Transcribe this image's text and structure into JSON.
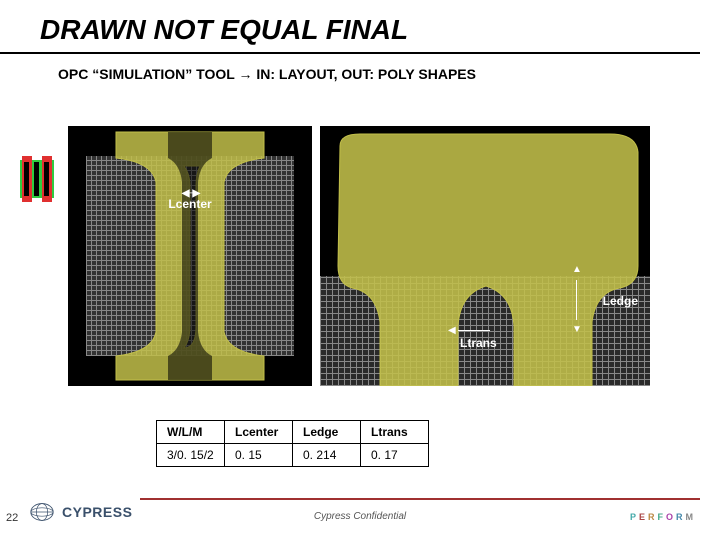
{
  "title": "DRAWN NOT EQUAL FINAL",
  "subtitle": "OPC “SIMULATION” TOOL → IN: LAYOUT, OUT:  POLY SHAPES",
  "labels": {
    "lcenter": "Lcenter",
    "ledge": "Ledge",
    "ltrans": "Ltrans"
  },
  "table": {
    "headers": [
      "W/L/M",
      "Lcenter",
      "Ledge",
      "Ltrans"
    ],
    "rows": [
      [
        "3/0. 15/2",
        "0. 15",
        "0. 214",
        "0. 17"
      ]
    ]
  },
  "footer": {
    "page": "22",
    "confidential": "Cypress Confidential",
    "brand": "CYPRESS",
    "perform": [
      "P",
      "E",
      "R",
      "F",
      "O",
      "R",
      "M"
    ]
  }
}
